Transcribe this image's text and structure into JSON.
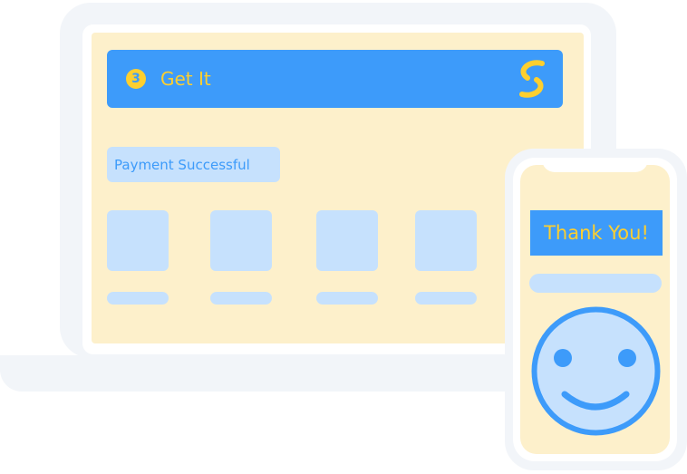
{
  "colors": {
    "brand_blue": "#3d9bfa",
    "brand_yellow": "#fdcf2f",
    "screen_bg": "#fdf0cb",
    "placeholder_blue": "#c6e1fd",
    "device_frame": "#f2f5f9"
  },
  "header": {
    "step_number": "3",
    "title": "Get It",
    "logo_icon": "brand-s-logo-icon"
  },
  "status": {
    "message": "Payment Successful"
  },
  "phone": {
    "thanks_text": "Thank You!",
    "illustration_icon": "smiley-face-icon"
  }
}
